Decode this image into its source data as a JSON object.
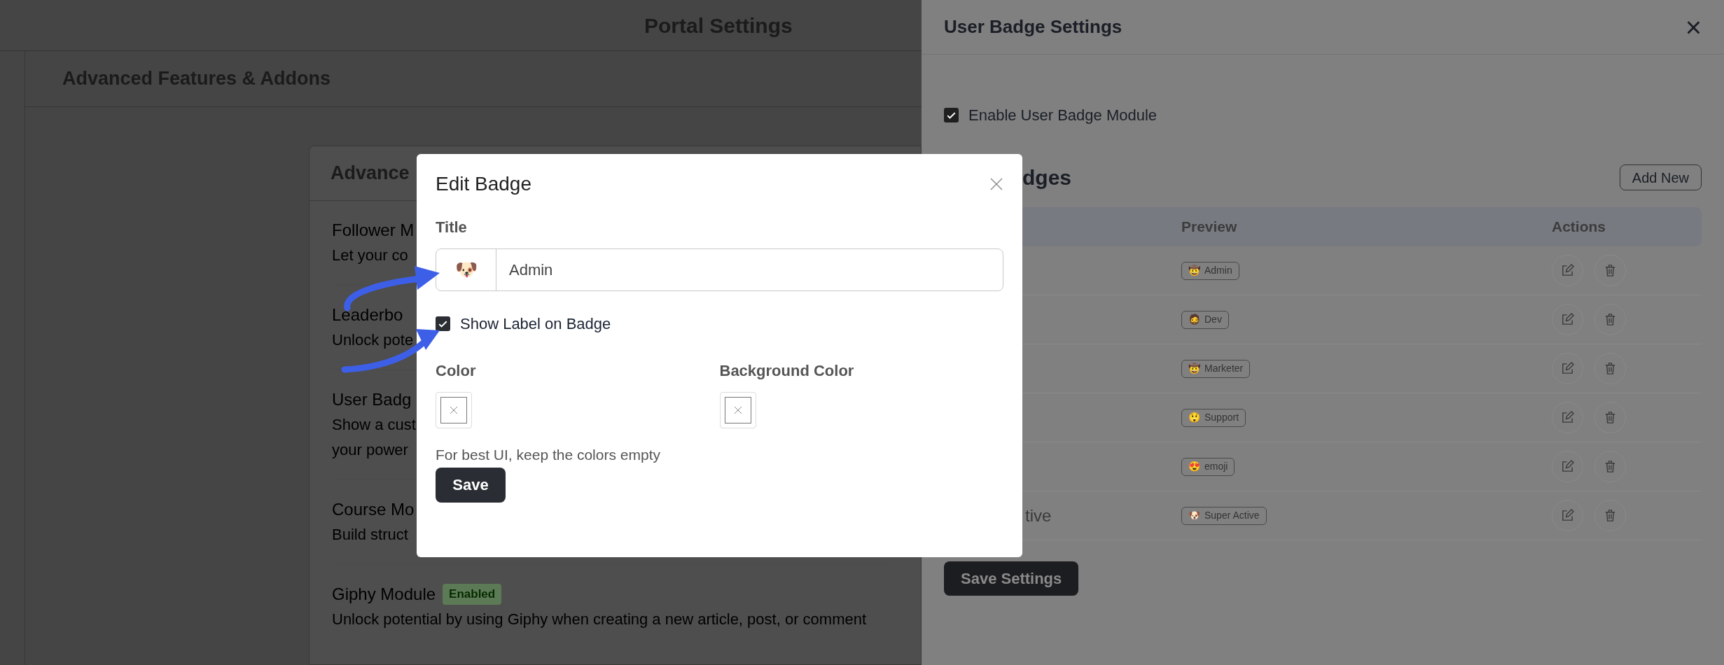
{
  "background_page": {
    "title": "Portal Settings",
    "section_title": "Advanced Features & Addons",
    "card_title": "Advance",
    "modules": [
      {
        "name": "Follower M",
        "description_lines": [
          "Let your co"
        ]
      },
      {
        "name": "Leaderbo",
        "description_lines": [
          "Unlock pote"
        ]
      },
      {
        "name": "User Badg",
        "description_lines": [
          "Show a cust",
          "your power"
        ]
      },
      {
        "name": "Course Mo",
        "description_lines": [
          "Build struct"
        ]
      },
      {
        "name": "Giphy Module",
        "status": "Enabled",
        "description_lines": [
          "Unlock potential by using Giphy when creating a new article, post, or comment"
        ]
      }
    ]
  },
  "side_panel": {
    "title": "User Badge Settings",
    "close": "×",
    "enable_module": {
      "label": "Enable User Badge Module",
      "checked": true
    },
    "badges_heading": "dges",
    "add_button": "Add New",
    "table": {
      "columns": [
        "Preview",
        "Actions"
      ],
      "rows": [
        {
          "emoji": "🤠",
          "label": "Admin"
        },
        {
          "emoji": "🧔",
          "label": "Dev"
        },
        {
          "emoji": "🤠",
          "label": "Marketer"
        },
        {
          "emoji": "😲",
          "label": "Support"
        },
        {
          "emoji": "😍",
          "label": "emoji"
        },
        {
          "column_1": "tive",
          "emoji": "🐶",
          "label": "Super Active"
        }
      ]
    },
    "save_button": "Save Settings"
  },
  "modal": {
    "title": "Edit Badge",
    "title_label": "Title",
    "emoji": "🐶",
    "title_value": "Admin",
    "show_label": {
      "label": "Show Label on Badge",
      "checked": true
    },
    "color_label": "Color",
    "background_color_label": "Background Color",
    "hint": "For best UI, keep the colors empty",
    "save_button": "Save"
  }
}
